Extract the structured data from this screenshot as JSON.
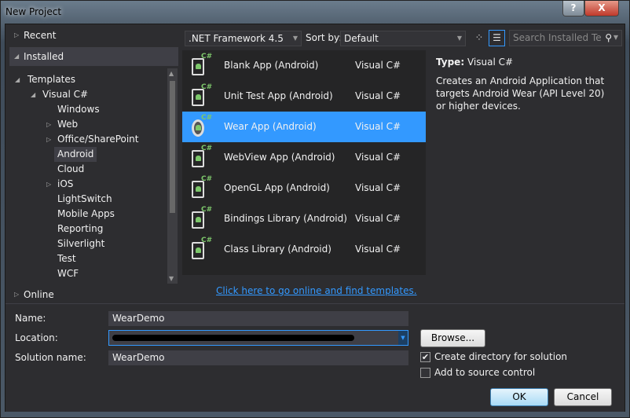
{
  "window": {
    "title": "New Project",
    "help": "?",
    "close": "X"
  },
  "left": {
    "recent": "Recent",
    "installed": "Installed",
    "online": "Online",
    "tree": [
      "Templates",
      "Visual C#",
      "Windows",
      "Web",
      "Office/SharePoint",
      "Android",
      "Cloud",
      "iOS",
      "LightSwitch",
      "Mobile Apps",
      "Reporting",
      "Silverlight",
      "Test",
      "WCF"
    ],
    "selected": "Android"
  },
  "toolbar": {
    "framework": ".NET Framework 4.5",
    "sort_label": "Sort by:",
    "sort_value": "Default",
    "search_placeholder": "Search Installed Te"
  },
  "templates": [
    {
      "name": "Blank App (Android)",
      "lang": "Visual C#"
    },
    {
      "name": "Unit Test App (Android)",
      "lang": "Visual C#"
    },
    {
      "name": "Wear App (Android)",
      "lang": "Visual C#",
      "selected": true
    },
    {
      "name": "WebView App (Android)",
      "lang": "Visual C#"
    },
    {
      "name": "OpenGL App (Android)",
      "lang": "Visual C#"
    },
    {
      "name": "Bindings Library (Android)",
      "lang": "Visual C#"
    },
    {
      "name": "Class Library (Android)",
      "lang": "Visual C#"
    }
  ],
  "online_link": "Click here to go online and find templates.",
  "details": {
    "type_label": "Type:",
    "type_value": "Visual C#",
    "description": "Creates an Android Application that targets Android Wear (API Level 20) or higher devices."
  },
  "form": {
    "name_label": "Name:",
    "name_value": "WearDemo",
    "location_label": "Location:",
    "solution_label": "Solution name:",
    "solution_value": "WearDemo",
    "browse": "Browse...",
    "create_dir": "Create directory for solution",
    "source_control": "Add to source control",
    "ok": "OK",
    "cancel": "Cancel"
  },
  "colors": {
    "selection": "#3399ff",
    "background": "#2d2d30",
    "link": "#3399ff"
  }
}
